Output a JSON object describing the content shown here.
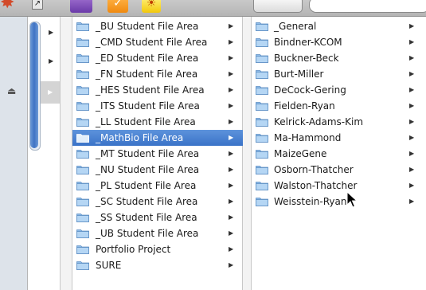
{
  "toolbar": {
    "icons": [
      "star-icon",
      "resize-arrow-icon",
      "purple-app-icon",
      "envelope-icon",
      "sun-icon"
    ]
  },
  "column0": {
    "arrows": [
      "▶",
      "▶",
      "▶"
    ]
  },
  "column_areas": {
    "items": [
      {
        "label": "_BU Student File Area",
        "has_children": true
      },
      {
        "label": "_CMD Student File Area",
        "has_children": true
      },
      {
        "label": "_ED Student File Area",
        "has_children": true
      },
      {
        "label": "_FN Student File Area",
        "has_children": true
      },
      {
        "label": "_HES Student File Area",
        "has_children": true
      },
      {
        "label": "_ITS Student File Area",
        "has_children": true
      },
      {
        "label": "_LL Student File Area",
        "has_children": true
      },
      {
        "label": "_MathBio File Area",
        "has_children": true,
        "selected": true
      },
      {
        "label": "_MT Student File Area",
        "has_children": true
      },
      {
        "label": "_NU Student File Area",
        "has_children": true
      },
      {
        "label": "_PL Student File Area",
        "has_children": true
      },
      {
        "label": "_SC Student File Area",
        "has_children": true
      },
      {
        "label": "_SS Student File Area",
        "has_children": true
      },
      {
        "label": "_UB Student File Area",
        "has_children": true
      },
      {
        "label": "Portfolio Project",
        "has_children": true
      },
      {
        "label": "SURE",
        "has_children": true
      }
    ]
  },
  "column_mathbio": {
    "items": [
      {
        "label": "_General"
      },
      {
        "label": "Bindner-KCOM"
      },
      {
        "label": "Buckner-Beck"
      },
      {
        "label": "Burt-Miller"
      },
      {
        "label": "DeCock-Gering"
      },
      {
        "label": "Fielden-Ryan"
      },
      {
        "label": "Kelrick-Adams-Kim"
      },
      {
        "label": "Ma-Hammond"
      },
      {
        "label": "MaizeGene"
      },
      {
        "label": "Osborn-Thatcher"
      },
      {
        "label": "Walston-Thatcher"
      },
      {
        "label": "Weisstein-Ryan"
      }
    ]
  },
  "colors": {
    "selection": "#3a73c8",
    "folder": "#7fb2e5",
    "sidebar": "#dde3ea"
  }
}
